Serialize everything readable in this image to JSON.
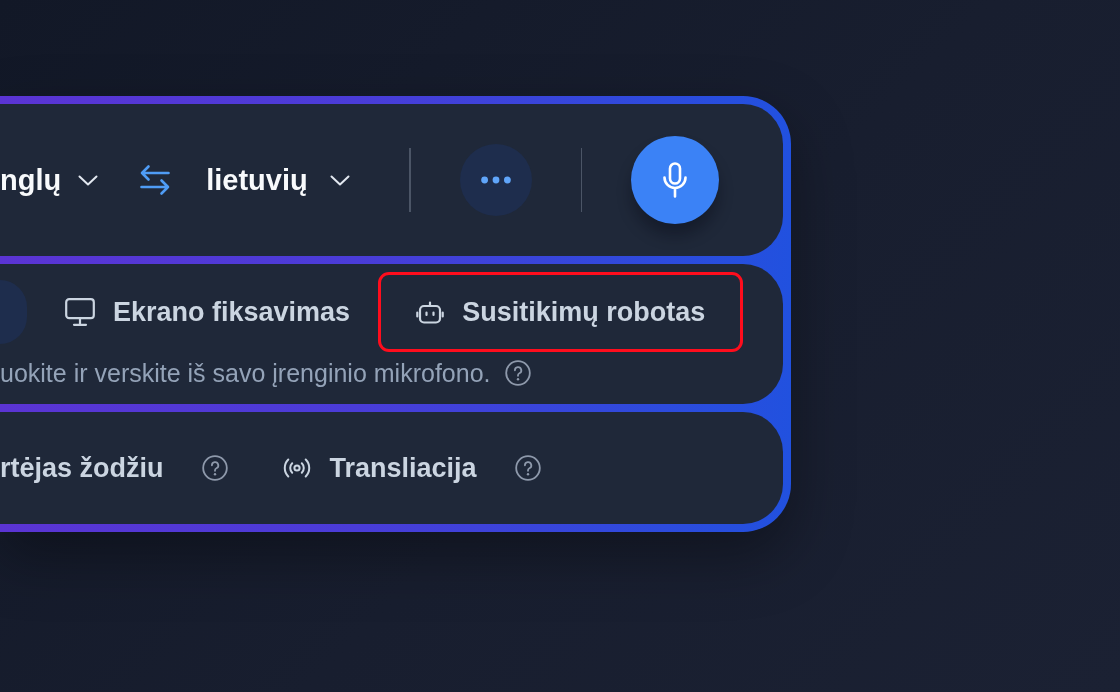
{
  "language_bar": {
    "source_language": "nglų",
    "target_language": "lietuvių"
  },
  "capture_tabs": [
    {
      "selected": true,
      "highlighted": false
    },
    {
      "label": "Ekrano fiksavimas",
      "selected": false,
      "highlighted": false
    },
    {
      "label": "Susitikimų robotas",
      "selected": false,
      "highlighted": true
    }
  ],
  "hint": "uokite ir verskite iš savo įrenginio mikrofono.",
  "modes": [
    {
      "kind": "plain",
      "label": "rtėjas žodžiu"
    },
    {
      "kind": "icon",
      "label": "Transliacija"
    }
  ]
}
